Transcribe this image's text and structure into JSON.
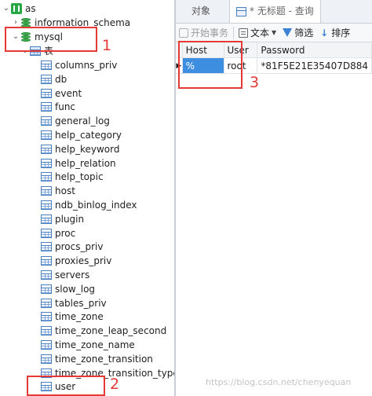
{
  "tree": {
    "connection": {
      "label": "as"
    },
    "databases": [
      {
        "label": "information_schema",
        "expanded": false
      },
      {
        "label": "mysql",
        "expanded": true
      }
    ],
    "tables_folder": {
      "label": "表"
    },
    "tables": [
      "columns_priv",
      "db",
      "event",
      "func",
      "general_log",
      "help_category",
      "help_keyword",
      "help_relation",
      "help_topic",
      "host",
      "ndb_binlog_index",
      "plugin",
      "proc",
      "procs_priv",
      "proxies_priv",
      "servers",
      "slow_log",
      "tables_priv",
      "time_zone",
      "time_zone_leap_second",
      "time_zone_name",
      "time_zone_transition",
      "time_zone_transition_type",
      "user"
    ]
  },
  "tabs": {
    "objects_label": "对象",
    "query_label": "* 无标题 - 查询"
  },
  "toolbar": {
    "begin_txn_label": "开始事务",
    "text_label": "文本",
    "filter_label": "筛选",
    "sort_label": "排序"
  },
  "grid": {
    "columns": [
      "Host",
      "User",
      "Password"
    ],
    "rows": [
      [
        "%",
        "root",
        "*81F5E21E35407D884"
      ]
    ],
    "row_marker": "▶"
  },
  "annotations": [
    "1",
    "2",
    "3"
  ],
  "watermark": "https://blog.csdn.net/chenyequan",
  "colors": {
    "annotation": "#e53935",
    "selection": "#3d8ee0",
    "connection_icon": "#27a844",
    "database_icon": "#3cad4c"
  }
}
